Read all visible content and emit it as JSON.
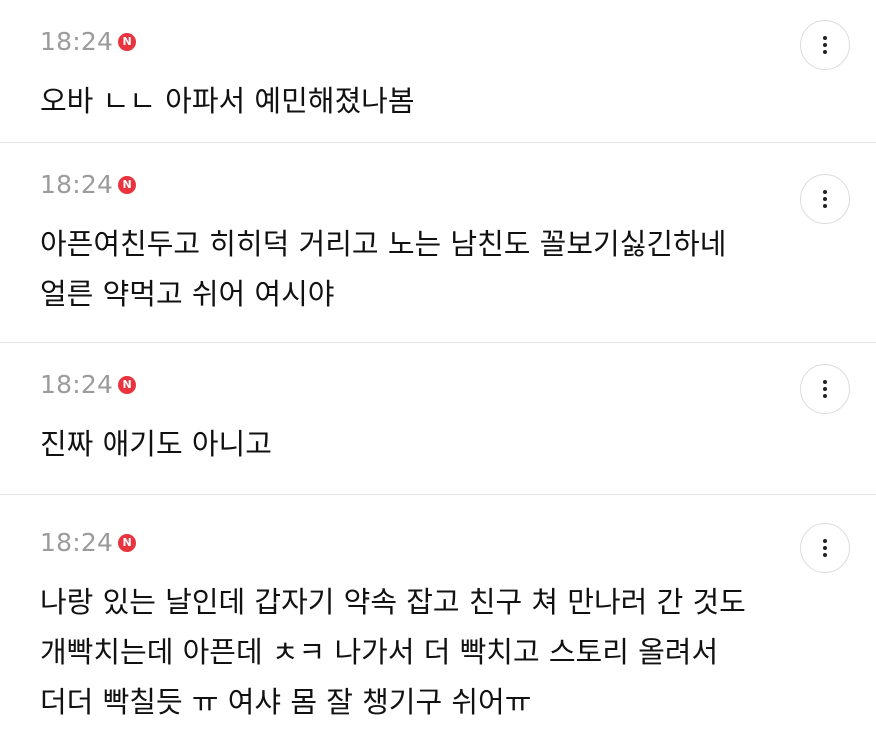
{
  "comments": [
    {
      "time": "18:24",
      "badge": "N",
      "text": "오바 ㄴㄴ 아파서 예민해졌나봄"
    },
    {
      "time": "18:24",
      "badge": "N",
      "text": "아픈여친두고 히히덕 거리고 노는 남친도 꼴보기싫긴하네\n얼른 약먹고 쉬어 여시야"
    },
    {
      "time": "18:24",
      "badge": "N",
      "text": "진짜 애기도 아니고"
    },
    {
      "time": "18:24",
      "badge": "N",
      "text": "나랑 있는 날인데 갑자기 약속 잡고 친구 쳐 만나러 간 것도\n개빡치는데 아픈데 ㅊㅋ 나가서 더 빡치고 스토리 올려서\n더더 빡칠듯 ㅠ 여샤 몸 잘 챙기구 쉬어ㅠ"
    }
  ],
  "icons": {
    "more": "more-vertical-icon",
    "new": "new-badge-icon"
  },
  "colors": {
    "badge": "#e8343f",
    "time": "#9b9b9b",
    "text": "#111111",
    "divider": "#e6e6e6"
  }
}
